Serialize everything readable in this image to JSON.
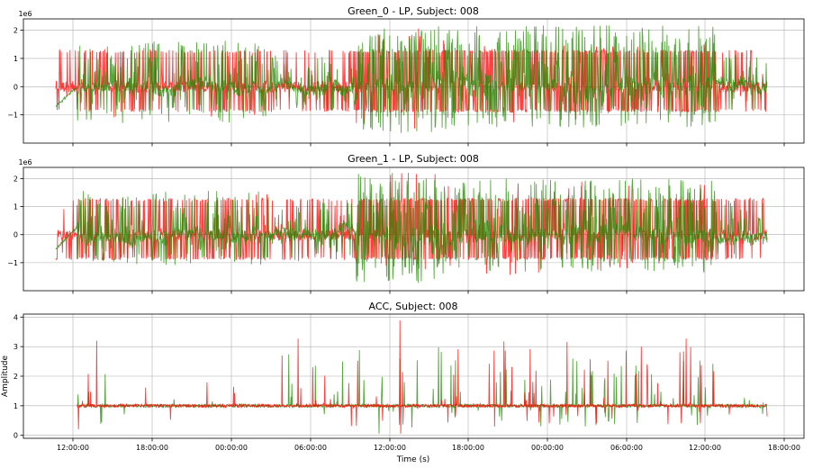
{
  "chart_data": [
    {
      "type": "line",
      "title": "Green_0 - LP, Subject: 008",
      "ylabel": "",
      "xlabel": "",
      "y_offset_label": "1e6",
      "ylim": [
        -2.0,
        2.4
      ],
      "yticks": [
        -1,
        0,
        1,
        2
      ],
      "ytick_labels": [
        "−1",
        "0",
        "1",
        "2"
      ],
      "grid": true,
      "series": [
        {
          "color": "#ff0000",
          "shape": "rect",
          "base": 0.0,
          "rect_high": 1.25,
          "rect_low": -0.85,
          "noise": 0.2,
          "segments": [
            [
              0.03,
              0.3,
              0.42,
              1.45,
              -1.15
            ],
            [
              0.3,
              0.42,
              0.25,
              1.05,
              -0.85
            ],
            [
              0.42,
              0.55,
              0.72,
              2.2,
              -1.75
            ],
            [
              0.55,
              0.93,
              0.7,
              1.5,
              -1.3
            ],
            [
              0.93,
              1.0,
              0.3,
              0.8,
              -0.8
            ]
          ]
        },
        {
          "color": "#228800",
          "shape": "walk",
          "base": 0.0,
          "noise": 0.35,
          "segments": [
            [
              0.0,
              0.03,
              0.0,
              0.0,
              -0.7
            ],
            [
              0.03,
              0.3,
              0.45,
              1.65,
              -1.3
            ],
            [
              0.3,
              0.42,
              0.3,
              1.2,
              -0.9
            ],
            [
              0.42,
              0.55,
              0.7,
              2.15,
              -1.65
            ],
            [
              0.55,
              0.93,
              0.65,
              2.2,
              -1.45
            ],
            [
              0.93,
              1.0,
              0.3,
              1.2,
              -0.85
            ]
          ]
        }
      ]
    },
    {
      "type": "line",
      "title": "Green_1 - LP, Subject: 008",
      "ylabel": "",
      "xlabel": "",
      "y_offset_label": "1e6",
      "ylim": [
        -2.0,
        2.4
      ],
      "yticks": [
        -1,
        0,
        1,
        2
      ],
      "ytick_labels": [
        "−1",
        "0",
        "1",
        "2"
      ],
      "grid": true,
      "series": [
        {
          "color": "#ff0000",
          "shape": "rect",
          "base": 0.0,
          "rect_high": 1.25,
          "rect_low": -0.85,
          "noise": 0.2,
          "segments": [
            [
              0.03,
              0.3,
              0.45,
              1.5,
              -1.0
            ],
            [
              0.3,
              0.42,
              0.25,
              1.4,
              -1.0
            ],
            [
              0.42,
              0.55,
              0.72,
              2.2,
              -1.55
            ],
            [
              0.55,
              0.93,
              0.7,
              1.9,
              -1.45
            ],
            [
              0.93,
              1.0,
              0.3,
              1.25,
              -0.85
            ]
          ]
        },
        {
          "color": "#228800",
          "shape": "walk",
          "base": 0.0,
          "noise": 0.35,
          "segments": [
            [
              0.0,
              0.03,
              0.0,
              0.25,
              -0.5
            ],
            [
              0.03,
              0.3,
              0.45,
              1.6,
              -1.1
            ],
            [
              0.3,
              0.42,
              0.3,
              1.2,
              -0.9
            ],
            [
              0.42,
              0.55,
              0.7,
              2.25,
              -1.75
            ],
            [
              0.55,
              0.93,
              0.65,
              2.0,
              -1.35
            ],
            [
              0.93,
              1.0,
              0.3,
              1.2,
              -0.7
            ]
          ]
        }
      ]
    },
    {
      "type": "line",
      "title": "ACC, Subject: 008",
      "ylabel": "Amplitude",
      "xlabel": "Time (s)",
      "ylim": [
        -0.1,
        4.1
      ],
      "yticks": [
        0,
        1,
        2,
        3,
        4
      ],
      "ytick_labels": [
        "0",
        "1",
        "2",
        "3",
        "4"
      ],
      "grid": true,
      "xtick_labels": [
        "12:00:00",
        "18:00:00",
        "00:00:00",
        "06:00:00",
        "12:00:00",
        "18:00:00",
        "00:00:00",
        "06:00:00",
        "12:00:00",
        "18:00:00"
      ],
      "series": [
        {
          "color": "#228800",
          "shape": "spikes",
          "base": 1.0,
          "noise": 0.05,
          "segments": [
            [
              0.0,
              0.03,
              0.0,
              0.0,
              0.0
            ],
            [
              0.03,
              0.07,
              0.12,
              2.6,
              0.2
            ],
            [
              0.07,
              0.3,
              0.03,
              1.3,
              0.7
            ],
            [
              0.3,
              0.55,
              0.15,
              3.1,
              0.05
            ],
            [
              0.55,
              0.93,
              0.2,
              2.6,
              0.25
            ],
            [
              0.93,
              1.0,
              0.06,
              1.3,
              0.7
            ]
          ]
        },
        {
          "color": "#ff0000",
          "shape": "spikes",
          "base": 1.0,
          "noise": 0.05,
          "segments": [
            [
              0.0,
              0.03,
              0.0,
              0.0,
              0.0
            ],
            [
              0.03,
              0.07,
              0.12,
              3.3,
              0.1
            ],
            [
              0.07,
              0.3,
              0.03,
              1.8,
              0.5
            ],
            [
              0.3,
              0.55,
              0.15,
              3.9,
              0.05
            ],
            [
              0.55,
              0.93,
              0.2,
              3.3,
              0.25
            ],
            [
              0.93,
              1.0,
              0.06,
              1.5,
              0.6
            ]
          ]
        }
      ]
    }
  ]
}
